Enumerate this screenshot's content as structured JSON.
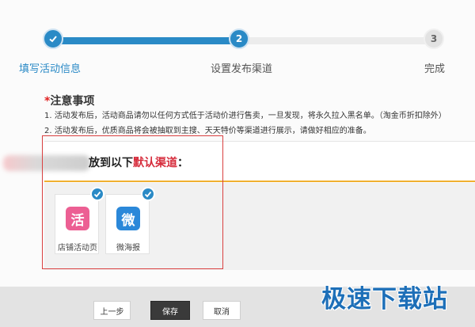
{
  "stepper": {
    "steps": [
      {
        "number": "1",
        "icon": "check-icon",
        "label": "填写活动信息",
        "state": "done"
      },
      {
        "number": "2",
        "label": "设置发布渠道",
        "state": "current"
      },
      {
        "number": "3",
        "label": "完成",
        "state": "pending"
      }
    ]
  },
  "notice": {
    "star": "*",
    "title": "注意事项",
    "lines": [
      "1.  活动发布后，活动商品请勿以任何方式低于活动价进行售卖，一旦发现，将永久拉入黑名单。（淘金币折扣除外）",
      "2.  活动发布后，优质商品将会被抽取到主搜、天天特价等渠道进行展示，请做好相应的准备。"
    ]
  },
  "channels": {
    "heading_prefix": "放到以下",
    "heading_highlight": "默认渠道",
    "heading_suffix": "：",
    "items": [
      {
        "label": "店铺活动页",
        "icon_char": "活",
        "icon": "huo-app-icon",
        "checked": true,
        "color": "#ec5f93"
      },
      {
        "label": "微海报",
        "icon_char": "微",
        "icon": "wei-app-icon",
        "checked": true,
        "color": "#2b88d9"
      }
    ]
  },
  "footer": {
    "prev_label": "上一步",
    "save_label": "保存",
    "cancel_label": "取消"
  },
  "watermark": "极速下载站",
  "colors": {
    "accent": "#2a8ac6",
    "highlight_red": "#d62b3b",
    "frame_red": "#d94040"
  }
}
